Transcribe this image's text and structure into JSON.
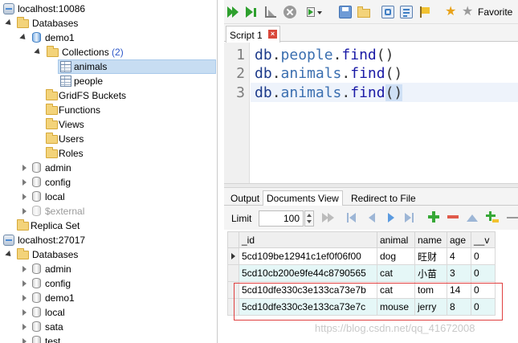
{
  "tree": [
    {
      "label": "localhost:10086",
      "icon": "server-icon"
    },
    {
      "label": "Databases",
      "icon": "folder-icon"
    },
    {
      "label": "demo1",
      "icon": "database-icon"
    },
    {
      "label": "Collections",
      "count": "(2)",
      "icon": "folder-icon"
    },
    {
      "label": "animals",
      "icon": "collection-icon",
      "selected": true
    },
    {
      "label": "people",
      "icon": "collection-icon"
    },
    {
      "label": "GridFS Buckets",
      "icon": "folder-icon"
    },
    {
      "label": "Functions",
      "icon": "folder-icon"
    },
    {
      "label": "Views",
      "icon": "folder-icon"
    },
    {
      "label": "Users",
      "icon": "folder-icon"
    },
    {
      "label": "Roles",
      "icon": "folder-icon"
    },
    {
      "label": "admin",
      "icon": "database-icon"
    },
    {
      "label": "config",
      "icon": "database-icon"
    },
    {
      "label": "local",
      "icon": "database-icon"
    },
    {
      "label": "$external",
      "icon": "database-icon"
    },
    {
      "label": "Replica Set",
      "icon": "folder-icon"
    },
    {
      "label": "localhost:27017",
      "icon": "server-icon"
    },
    {
      "label": "Databases",
      "icon": "folder-icon"
    },
    {
      "label": "admin",
      "icon": "database-icon"
    },
    {
      "label": "config",
      "icon": "database-icon"
    },
    {
      "label": "demo1",
      "icon": "database-icon"
    },
    {
      "label": "local",
      "icon": "database-icon"
    },
    {
      "label": "sata",
      "icon": "database-icon"
    },
    {
      "label": "test",
      "icon": "database-icon"
    }
  ],
  "toolbar": {
    "favorites_label": "Favorite",
    "colors": {
      "run": "#2ea02e",
      "accent": "#3f7fc4"
    }
  },
  "script_tab": {
    "label": "Script 1",
    "close": "×"
  },
  "editor": {
    "lines": [
      {
        "num": "1",
        "db": "db",
        "coll": "people",
        "fn": "find",
        "paren": "()"
      },
      {
        "num": "2",
        "db": "db",
        "coll": "animals",
        "fn": "find",
        "paren": "()"
      },
      {
        "num": "3",
        "db": "db",
        "coll": "animals",
        "fn": "find",
        "paren": "()"
      }
    ]
  },
  "result_tabs": [
    "Output",
    "Documents View",
    "Redirect to File"
  ],
  "result_toolbar": {
    "limit_label": "Limit",
    "limit_value": "100"
  },
  "grid": {
    "columns": [
      "_id",
      "animal",
      "name",
      "age",
      "__v"
    ],
    "rows": [
      [
        "5cd109be12941c1ef0f06f00",
        "dog",
        "旺财",
        "4",
        "0"
      ],
      [
        "5cd10cb200e9fe44c8790565",
        "cat",
        "小苗",
        "3",
        "0"
      ],
      [
        "5cd10dfe330c3e133ca73e7b",
        "cat",
        "tom",
        "14",
        "0"
      ],
      [
        "5cd10dfe330c3e133ca73e7c",
        "mouse",
        "jerry",
        "8",
        "0"
      ]
    ]
  },
  "watermark": "https://blog.csdn.net/qq_41672008"
}
